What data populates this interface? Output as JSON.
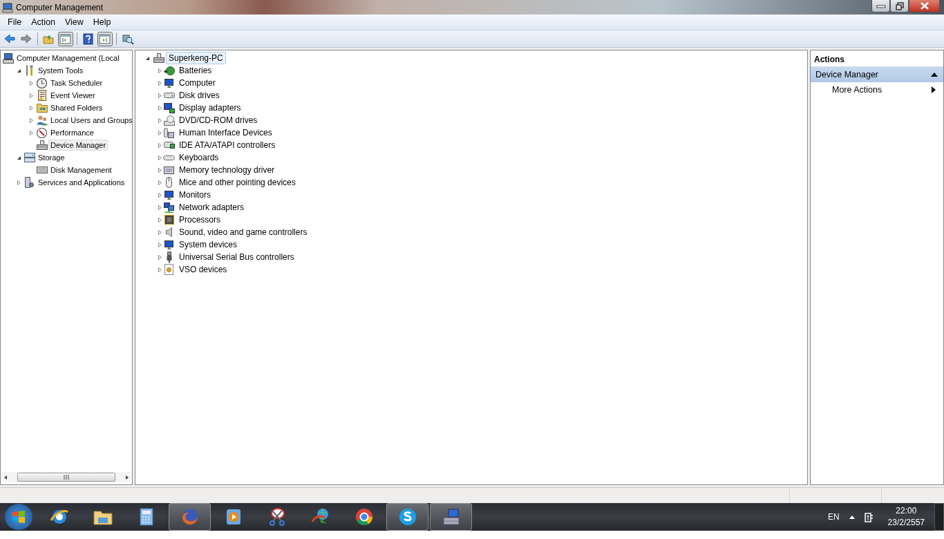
{
  "window": {
    "title": "Computer Management"
  },
  "menu": [
    {
      "label": "File"
    },
    {
      "label": "Action"
    },
    {
      "label": "View"
    },
    {
      "label": "Help"
    }
  ],
  "console_tree": [
    {
      "label": "Computer Management (Local",
      "selected": false,
      "children": [
        {
          "label": "System Tools",
          "expanded": true,
          "selected": false,
          "children": [
            {
              "label": "Task Scheduler",
              "expanded": false,
              "selected": false
            },
            {
              "label": "Event Viewer",
              "expanded": false,
              "selected": false
            },
            {
              "label": "Shared Folders",
              "expanded": false,
              "selected": false
            },
            {
              "label": "Local Users and Groups",
              "expanded": false,
              "selected": false
            },
            {
              "label": "Performance",
              "expanded": false,
              "selected": false
            },
            {
              "label": "Device Manager",
              "selected": true
            }
          ]
        },
        {
          "label": "Storage",
          "expanded": true,
          "selected": false,
          "children": [
            {
              "label": "Disk Management",
              "selected": false
            }
          ]
        },
        {
          "label": "Services and Applications",
          "expanded": false,
          "selected": false
        }
      ]
    }
  ],
  "device_tree": {
    "label": "Superkeng-PC",
    "expanded": true,
    "selected": true,
    "children": [
      {
        "label": "Batteries",
        "expanded": false
      },
      {
        "label": "Computer",
        "expanded": false
      },
      {
        "label": "Disk drives",
        "expanded": false
      },
      {
        "label": "Display adapters",
        "expanded": false
      },
      {
        "label": "DVD/CD-ROM drives",
        "expanded": false
      },
      {
        "label": "Human Interface Devices",
        "expanded": false
      },
      {
        "label": "IDE ATA/ATAPI controllers",
        "expanded": false
      },
      {
        "label": "Keyboards",
        "expanded": false
      },
      {
        "label": "Memory technology driver",
        "expanded": false
      },
      {
        "label": "Mice and other pointing devices",
        "expanded": false
      },
      {
        "label": "Monitors",
        "expanded": false
      },
      {
        "label": "Network adapters",
        "expanded": false
      },
      {
        "label": "Processors",
        "expanded": false
      },
      {
        "label": "Sound, video and game controllers",
        "expanded": false
      },
      {
        "label": "System devices",
        "expanded": false
      },
      {
        "label": "Universal Serial Bus controllers",
        "expanded": false
      },
      {
        "label": "VSO devices",
        "expanded": false
      }
    ]
  },
  "actions": {
    "title": "Actions",
    "sections": [
      {
        "label": "Device Manager",
        "expanded": true,
        "items": [
          {
            "label": "More Actions"
          }
        ]
      }
    ]
  },
  "taskbar": {
    "apps": [
      {
        "active": false
      },
      {
        "active": false
      },
      {
        "active": false
      },
      {
        "active": true
      },
      {
        "active": false
      },
      {
        "active": false
      },
      {
        "active": false
      },
      {
        "active": false
      },
      {
        "active": true
      },
      {
        "active": true
      }
    ],
    "language": "EN",
    "time": "22:00",
    "date": "23/2/2557"
  }
}
